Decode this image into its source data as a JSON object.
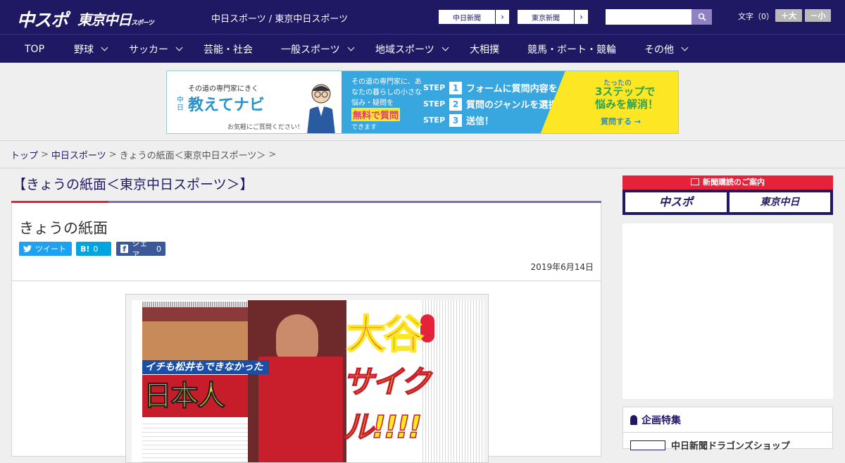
{
  "header": {
    "logo_chuspo": "中スポ",
    "logo_tokyo": "東京中日",
    "logo_tokyo_small": "スポーツ",
    "site_title": "中日スポーツ / 東京中日スポーツ",
    "links": [
      {
        "label": "中日新聞"
      },
      {
        "label": "東京新聞"
      }
    ],
    "search": {
      "value": "",
      "placeholder": ""
    },
    "font_size_label": "文字（0）",
    "font_larger": "＋大",
    "font_smaller": "－小"
  },
  "nav": {
    "items": [
      {
        "label": "TOP",
        "dropdown": false
      },
      {
        "label": "野球",
        "dropdown": true
      },
      {
        "label": "サッカー",
        "dropdown": true
      },
      {
        "label": "芸能・社会",
        "dropdown": false
      },
      {
        "label": "一般スポーツ",
        "dropdown": true
      },
      {
        "label": "地域スポーツ",
        "dropdown": true
      },
      {
        "label": "大相撲",
        "dropdown": false
      },
      {
        "label": "競馬・ボート・競輪",
        "dropdown": false
      },
      {
        "label": "その他",
        "dropdown": true
      }
    ]
  },
  "banner": {
    "tagline": "その道の専門家にきく",
    "brand_prefix": "中日",
    "title": "教えてナビ",
    "footnote": "お気軽にご質問ください！",
    "mid_text": "その道の専門家に、あなたの暮らしの小さな悩み・疑問を",
    "free": "無料で質問",
    "mid_suffix": "できます",
    "steps": [
      {
        "label": "STEP",
        "num": "1",
        "text": "フォームに質問内容を入力"
      },
      {
        "label": "STEP",
        "num": "2",
        "text": "質問のジャンルを選択"
      },
      {
        "label": "STEP",
        "num": "3",
        "text": "送信！"
      }
    ],
    "right_small": "たったの",
    "right_big1": "3ステップで",
    "right_big2": "悩みを解消！",
    "right_button": "質問する →"
  },
  "breadcrumb": {
    "items": [
      {
        "label": "トップ",
        "link": true
      },
      {
        "label": "中日スポーツ",
        "link": true
      },
      {
        "label": "きょうの紙面＜東京中日スポーツ＞",
        "link": false
      }
    ],
    "separator": ">"
  },
  "main": {
    "section_heading": "【きょうの紙面＜東京中日スポーツ＞】",
    "title": "きょうの紙面",
    "share": {
      "tweet": "ツイート",
      "hatena_icon": "B!",
      "hatena_count": "0",
      "facebook": "シェア",
      "facebook_count": "0"
    },
    "date": "2019年6月14日",
    "paper": {
      "sub_headline": "イチも松井もできなかった",
      "headline_left": "日本人初",
      "headline_name": "大谷",
      "headline_main": "サイクル!!!!"
    }
  },
  "sidebar": {
    "subscription_heading": "新聞購読のご案内",
    "logos": [
      "中スポ",
      "東京中日"
    ],
    "feature_heading": "企画特集",
    "feature_item": "中日新聞ドラゴンズショップ"
  },
  "colors": {
    "navy": "#1f1863",
    "accent_red": "#e5223a",
    "accent_purple": "#7f6fb2",
    "twitter": "#1da1f2",
    "hatena": "#00a4de",
    "facebook": "#3b5998"
  }
}
